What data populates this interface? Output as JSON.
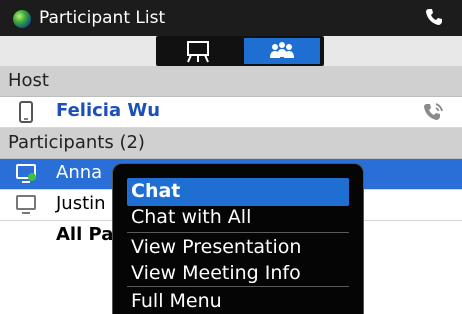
{
  "app": {
    "title": "Participant List"
  },
  "sections": {
    "host_label": "Host",
    "participants_label": "Participants (2)"
  },
  "host": {
    "name": "Felicia Wu"
  },
  "participants": [
    {
      "name": "Anna",
      "selected": true
    },
    {
      "name": "Justin",
      "selected": false
    },
    {
      "name": "All Participants",
      "selected": false
    }
  ],
  "context_menu": {
    "items": [
      "Chat",
      "Chat with All",
      "View Presentation",
      "View Meeting Info",
      "Full Menu"
    ],
    "highlighted": "Chat"
  },
  "colors": {
    "accent": "#2a6fd8",
    "title_bar": "#1c1c1c",
    "section_header": "#d0d0d0",
    "host_name": "#1c4fb8"
  },
  "icons": {
    "title": "globe-icon",
    "title_action": "phone-icon",
    "tab_presentation": "presentation-icon",
    "tab_participants": "participants-icon",
    "host_device": "mobile-phone-icon",
    "host_status": "speaking-phone-icon",
    "participant_device": "computer-icon"
  }
}
